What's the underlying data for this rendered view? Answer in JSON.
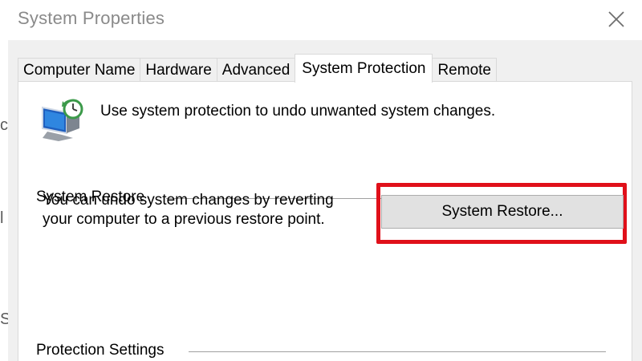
{
  "window": {
    "title": "System Properties",
    "close_label": "Close"
  },
  "tabs": [
    {
      "label": "Computer Name",
      "active": false
    },
    {
      "label": "Hardware",
      "active": false
    },
    {
      "label": "Advanced",
      "active": false
    },
    {
      "label": "System Protection",
      "active": true
    },
    {
      "label": "Remote",
      "active": false
    }
  ],
  "protection": {
    "intro_text": "Use system protection to undo unwanted system changes."
  },
  "system_restore": {
    "group_title": "System Restore",
    "description": "You can undo system changes by reverting your computer to a previous restore point.",
    "button_label": "System Restore..."
  },
  "protection_settings": {
    "group_title": "Protection Settings"
  },
  "colors": {
    "highlight_border": "#e0101a",
    "title_text": "#8a8a8a"
  }
}
